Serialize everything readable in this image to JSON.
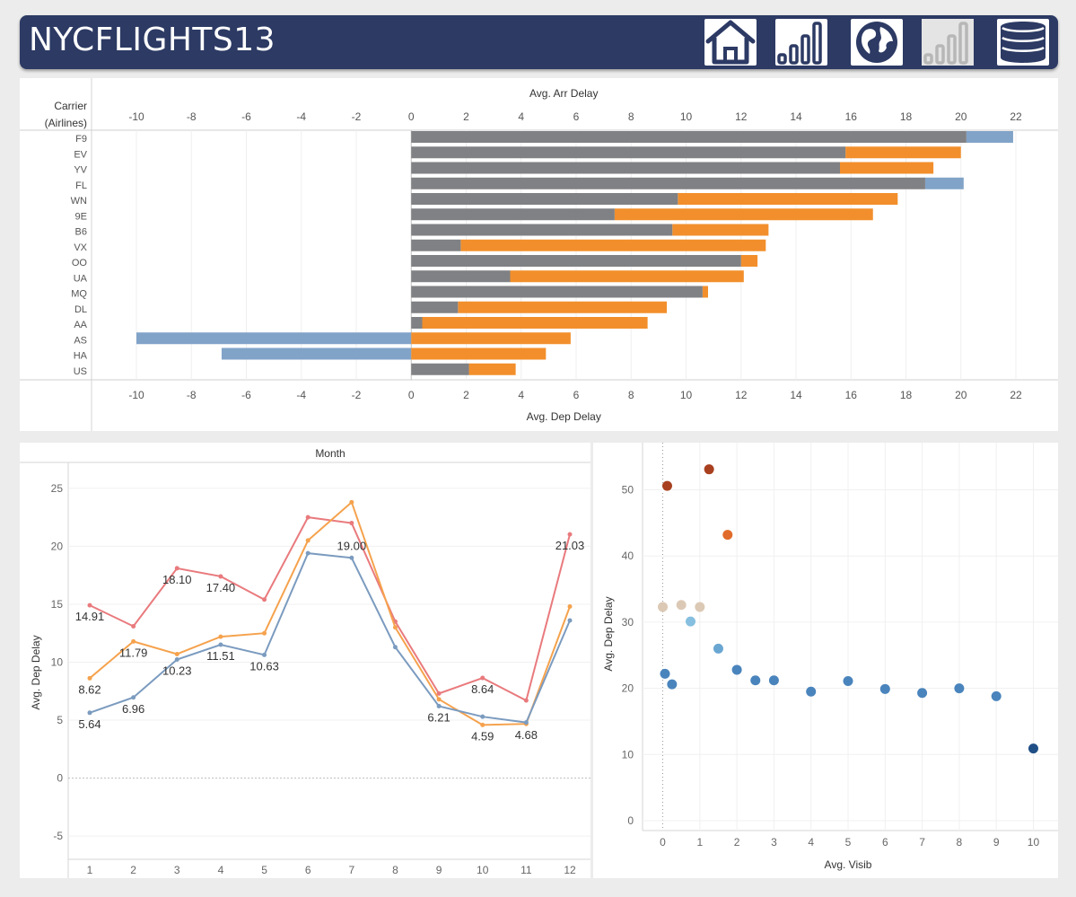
{
  "header": {
    "title": "NYCFLIGHTS13",
    "nav": [
      {
        "name": "home-icon",
        "active": true
      },
      {
        "name": "bar-chart-icon",
        "active": true
      },
      {
        "name": "globe-icon",
        "active": true
      },
      {
        "name": "bar-chart-icon-inactive",
        "active": false
      },
      {
        "name": "database-icon",
        "active": true
      }
    ]
  },
  "colors": {
    "dep": "#808184",
    "arr_pos": "#f28f2c",
    "arr_neg": "#81a3c8",
    "header": "#2c3a64"
  },
  "chart_data": [
    {
      "type": "bar",
      "title": "",
      "row_header": [
        "Carrier",
        "(Airlines)"
      ],
      "top_axis_label": "Avg. Arr Delay",
      "bottom_axis_label": "Avg. Dep Delay",
      "xlim": [
        -10,
        22
      ],
      "ticks": [
        "-10",
        "-8",
        "-6",
        "-4",
        "-2",
        "0",
        "2",
        "4",
        "6",
        "8",
        "10",
        "12",
        "14",
        "16",
        "18",
        "20",
        "22"
      ],
      "categories": [
        "F9",
        "EV",
        "YV",
        "FL",
        "WN",
        "9E",
        "B6",
        "VX",
        "OO",
        "UA",
        "MQ",
        "DL",
        "AA",
        "AS",
        "HA",
        "US"
      ],
      "series": [
        {
          "name": "Avg. Dep Delay",
          "values": [
            20.2,
            15.8,
            15.6,
            18.7,
            9.7,
            7.4,
            9.5,
            1.8,
            12.0,
            3.6,
            10.6,
            1.7,
            0.4,
            0,
            0,
            2.1
          ]
        },
        {
          "name": "Avg. Arr Delay",
          "values": [
            21.9,
            20.0,
            19.0,
            20.1,
            17.7,
            16.8,
            13.0,
            12.9,
            12.6,
            12.1,
            10.8,
            9.3,
            8.6,
            5.8,
            4.9,
            3.8
          ]
        },
        {
          "name": "Avg. Arr Delay (negative)",
          "values": [
            0,
            0,
            0,
            0,
            0,
            0,
            0,
            0,
            0,
            0,
            0,
            0,
            0,
            -10.0,
            -6.9,
            0
          ]
        }
      ],
      "grid": true
    },
    {
      "type": "line",
      "title": "Month",
      "ylabel": "Avg. Dep Delay",
      "ylim": [
        -7,
        27
      ],
      "yticks": [
        "-5",
        "0",
        "5",
        "10",
        "15",
        "20",
        "25"
      ],
      "x": [
        "1",
        "2",
        "3",
        "4",
        "5",
        "6",
        "7",
        "8",
        "9",
        "10",
        "11",
        "12"
      ],
      "series": [
        {
          "color": "#e97a7d",
          "values": [
            14.91,
            13.1,
            18.1,
            17.4,
            15.4,
            22.5,
            22.0,
            13.5,
            7.3,
            8.64,
            6.7,
            21.03
          ]
        },
        {
          "color": "#f5a24d",
          "values": [
            8.62,
            11.79,
            10.7,
            12.2,
            12.5,
            20.5,
            23.8,
            13.0,
            6.8,
            4.59,
            4.68,
            14.8
          ]
        },
        {
          "color": "#7b9bbf",
          "values": [
            5.64,
            6.96,
            10.23,
            11.51,
            10.63,
            19.4,
            19.0,
            11.3,
            6.21,
            5.3,
            4.8,
            13.6
          ]
        }
      ],
      "labels": [
        {
          "i": 0,
          "s": 0,
          "text": "14.91",
          "pos": "below"
        },
        {
          "i": 2,
          "s": 0,
          "text": "18.10",
          "pos": "below"
        },
        {
          "i": 3,
          "s": 0,
          "text": "17.40",
          "pos": "below"
        },
        {
          "i": 9,
          "s": 0,
          "text": "8.64",
          "pos": "below"
        },
        {
          "i": 11,
          "s": 0,
          "text": "21.03",
          "pos": "below"
        },
        {
          "i": 0,
          "s": 1,
          "text": "8.62",
          "pos": "below"
        },
        {
          "i": 1,
          "s": 1,
          "text": "11.79",
          "pos": "below"
        },
        {
          "i": 9,
          "s": 1,
          "text": "4.59",
          "pos": "below"
        },
        {
          "i": 10,
          "s": 1,
          "text": "4.68",
          "pos": "below"
        },
        {
          "i": 0,
          "s": 2,
          "text": "5.64",
          "pos": "below"
        },
        {
          "i": 1,
          "s": 2,
          "text": "6.96",
          "pos": "below"
        },
        {
          "i": 2,
          "s": 2,
          "text": "10.23",
          "pos": "below"
        },
        {
          "i": 3,
          "s": 2,
          "text": "11.51",
          "pos": "below"
        },
        {
          "i": 4,
          "s": 2,
          "text": "10.63",
          "pos": "below"
        },
        {
          "i": 6,
          "s": 2,
          "text": "19.00",
          "pos": "above"
        },
        {
          "i": 8,
          "s": 2,
          "text": "6.21",
          "pos": "below"
        }
      ]
    },
    {
      "type": "scatter",
      "xlabel": "Avg. Visib",
      "ylabel": "Avg. Dep Delay",
      "xlim": [
        -0.4,
        10.4
      ],
      "ylim": [
        -1.5,
        55.5
      ],
      "xticks": [
        "0",
        "1",
        "2",
        "3",
        "4",
        "5",
        "6",
        "7",
        "8",
        "9",
        "10"
      ],
      "yticks": [
        "0",
        "10",
        "20",
        "30",
        "40",
        "50"
      ],
      "points": [
        {
          "x": 0.12,
          "y": 50.6,
          "color": "#a8401f"
        },
        {
          "x": 1.25,
          "y": 53.1,
          "color": "#a8401f"
        },
        {
          "x": 1.75,
          "y": 43.2,
          "color": "#e06b2a"
        },
        {
          "x": 0.0,
          "y": 32.3,
          "color": "#dcc9b5"
        },
        {
          "x": 0.5,
          "y": 32.6,
          "color": "#dcc9b5"
        },
        {
          "x": 1.0,
          "y": 32.3,
          "color": "#dcc9b5"
        },
        {
          "x": 0.75,
          "y": 30.1,
          "color": "#86bfdf"
        },
        {
          "x": 1.5,
          "y": 26.0,
          "color": "#6aa6d2"
        },
        {
          "x": 0.06,
          "y": 22.2,
          "color": "#4a84bc"
        },
        {
          "x": 0.25,
          "y": 20.6,
          "color": "#4a84bc"
        },
        {
          "x": 2.0,
          "y": 22.8,
          "color": "#4a84bc"
        },
        {
          "x": 2.5,
          "y": 21.2,
          "color": "#4a84bc"
        },
        {
          "x": 3.0,
          "y": 21.2,
          "color": "#4a84bc"
        },
        {
          "x": 4.0,
          "y": 19.5,
          "color": "#4a84bc"
        },
        {
          "x": 5.0,
          "y": 21.1,
          "color": "#4a84bc"
        },
        {
          "x": 6.0,
          "y": 19.9,
          "color": "#4a84bc"
        },
        {
          "x": 7.0,
          "y": 19.3,
          "color": "#4a84bc"
        },
        {
          "x": 8.0,
          "y": 20.0,
          "color": "#4a84bc"
        },
        {
          "x": 9.0,
          "y": 18.8,
          "color": "#4a84bc"
        },
        {
          "x": 10.0,
          "y": 10.9,
          "color": "#204f86"
        }
      ]
    }
  ]
}
